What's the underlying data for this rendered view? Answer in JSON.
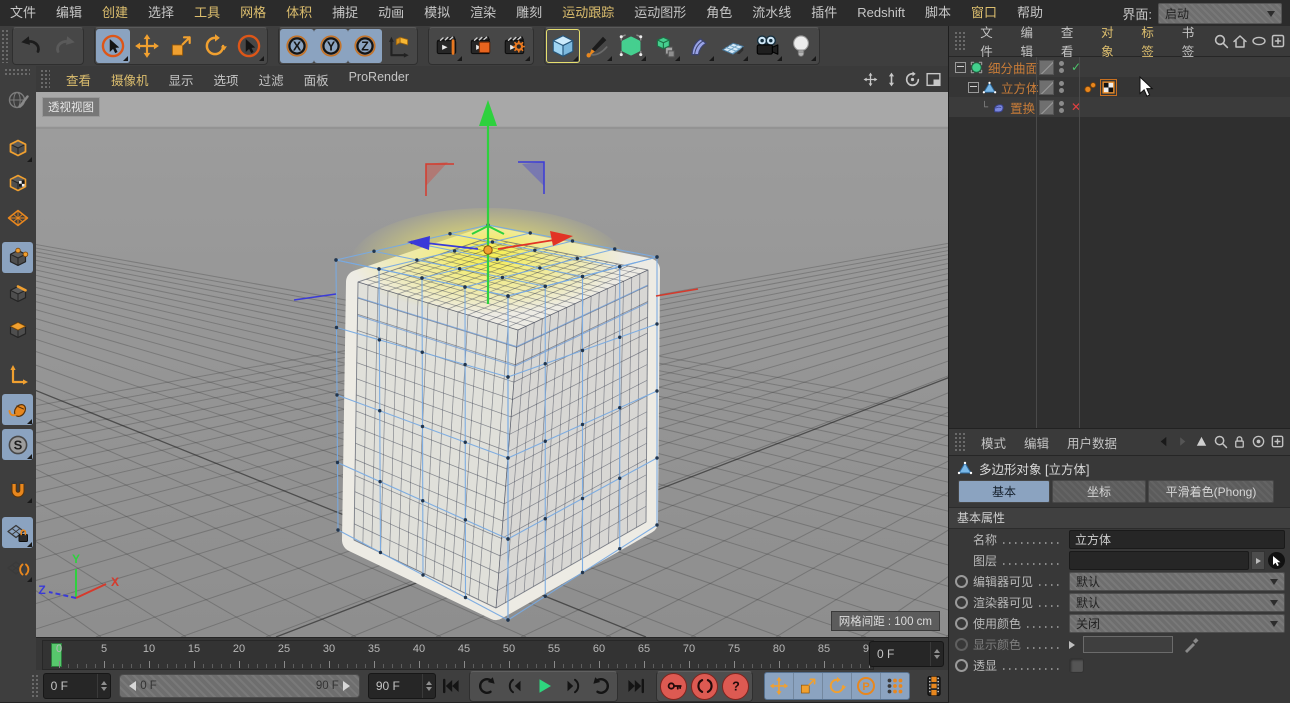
{
  "window": {
    "interface_label": "界面:",
    "interface_value": "启动"
  },
  "menubar": {
    "items": [
      {
        "label": "文件",
        "accent": false
      },
      {
        "label": "编辑",
        "accent": false
      },
      {
        "label": "创建",
        "accent": true
      },
      {
        "label": "选择",
        "accent": false
      },
      {
        "label": "工具",
        "accent": true
      },
      {
        "label": "网格",
        "accent": true
      },
      {
        "label": "体积",
        "accent": true
      },
      {
        "label": "捕捉",
        "accent": false
      },
      {
        "label": "动画",
        "accent": false
      },
      {
        "label": "模拟",
        "accent": false
      },
      {
        "label": "渲染",
        "accent": false
      },
      {
        "label": "雕刻",
        "accent": false
      },
      {
        "label": "运动跟踪",
        "accent": true
      },
      {
        "label": "运动图形",
        "accent": false
      },
      {
        "label": "角色",
        "accent": false
      },
      {
        "label": "流水线",
        "accent": false
      },
      {
        "label": "插件",
        "accent": false
      },
      {
        "label": "Redshift",
        "accent": false
      },
      {
        "label": "脚本",
        "accent": false
      },
      {
        "label": "窗口",
        "accent": true
      },
      {
        "label": "帮助",
        "accent": false
      }
    ]
  },
  "toolbar": {
    "groups": [
      [
        "undo",
        "redo"
      ],
      [
        "live-selection",
        "move",
        "scale",
        "rotate",
        "selection"
      ],
      [
        "axis-x",
        "axis-y",
        "axis-z",
        "coord-system"
      ],
      [
        "render-view",
        "render-region",
        "render-settings"
      ],
      [
        "primitive-cube",
        "spline-pen",
        "subdivision-surface",
        "array-generator",
        "deformer",
        "floor",
        "camera",
        "light"
      ]
    ],
    "blue_active": [
      "live-selection",
      "axis-x",
      "axis-y",
      "axis-z"
    ],
    "yellow_active": [
      "primitive-cube"
    ],
    "disabled": [
      "redo"
    ],
    "submenu_corner": [
      "live-selection",
      "selection",
      "render-view",
      "render-settings",
      "primitive-cube",
      "spline-pen",
      "subdivision-surface",
      "array-generator",
      "deformer",
      "floor",
      "camera",
      "light"
    ]
  },
  "left_toolbar": {
    "items": [
      "paint-globe",
      "model-mode",
      "texture-mode",
      "workplane-mode",
      "points-mode",
      "edges-mode",
      "polygons-mode",
      "axis-mode",
      "viewport-solo",
      "soft-selection",
      "snap",
      "workplane-lock",
      "workplane-orient"
    ],
    "blue_active": [
      "points-mode",
      "viewport-solo",
      "soft-selection",
      "workplane-lock"
    ],
    "disabled": [
      "paint-globe"
    ],
    "submenu_corner": [
      "model-mode",
      "viewport-solo",
      "soft-selection",
      "snap",
      "workplane-lock",
      "workplane-orient"
    ]
  },
  "viewport": {
    "menu": [
      {
        "label": "查看",
        "accent": true
      },
      {
        "label": "摄像机",
        "accent": true
      },
      {
        "label": "显示",
        "accent": false
      },
      {
        "label": "选项",
        "accent": false
      },
      {
        "label": "过滤",
        "accent": false
      },
      {
        "label": "面板",
        "accent": false
      },
      {
        "label": "ProRender",
        "accent": false
      }
    ],
    "corner_icons": [
      "pan",
      "dolly",
      "orbit",
      "layout"
    ],
    "view_label": "透视视图",
    "grid_spacing_label": "网格间距 : 100 cm",
    "axis_labels": {
      "x": "X",
      "y": "Y",
      "z": "Z"
    }
  },
  "object_manager": {
    "menu": [
      {
        "label": "文件",
        "accent": false
      },
      {
        "label": "编辑",
        "accent": false
      },
      {
        "label": "查看",
        "accent": false
      },
      {
        "label": "对象",
        "accent": true
      },
      {
        "label": "标签",
        "accent": true
      },
      {
        "label": "书签",
        "accent": false
      }
    ],
    "corner_icons": [
      "search",
      "home",
      "eye",
      "addbox"
    ],
    "objects": [
      {
        "name": "细分曲面",
        "icon": "subdivision-surface-object",
        "depth": 0,
        "expanded": true,
        "state": "check",
        "tags": []
      },
      {
        "name": "立方体",
        "icon": "polygon-object",
        "depth": 1,
        "expanded": true,
        "state": "",
        "tags": [
          "phong-tag",
          "texture-tag"
        ]
      },
      {
        "name": "置换",
        "icon": "displacer-object",
        "depth": 2,
        "expanded": false,
        "state": "x",
        "tags": []
      }
    ]
  },
  "attribute_manager": {
    "menu": [
      "模式",
      "编辑",
      "用户数据"
    ],
    "corner_icons": [
      "back",
      "fwd",
      "uparrow",
      "search",
      "lock",
      "target",
      "addbox"
    ],
    "title": "多边形对象 [立方体]",
    "tabs": [
      {
        "label": "基本",
        "active": true
      },
      {
        "label": "坐标",
        "active": false
      },
      {
        "label": "平滑着色(Phong)",
        "active": false
      }
    ],
    "section": "基本属性",
    "fields": [
      {
        "label": "名称",
        "type": "text",
        "value": "立方体",
        "radio": "none"
      },
      {
        "label": "图层",
        "type": "layer",
        "value": "",
        "radio": "none"
      },
      {
        "label": "编辑器可见",
        "type": "select",
        "value": "默认",
        "radio": "on"
      },
      {
        "label": "渲染器可见",
        "type": "select",
        "value": "默认",
        "radio": "on"
      },
      {
        "label": "使用颜色",
        "type": "select",
        "value": "关闭",
        "radio": "on"
      },
      {
        "label": "显示颜色",
        "type": "color",
        "value": "",
        "radio": "off"
      },
      {
        "label": "透显",
        "type": "checkbox",
        "value": "off",
        "radio": "on"
      }
    ]
  },
  "timeline": {
    "min": 0,
    "max": 90,
    "label_step": 5,
    "current_frame_label": "0 F",
    "range_start_label": "0 F",
    "range_end_label": "90 F",
    "end_frame_label": "90 F"
  },
  "transport": {
    "buttons": [
      "goto-start"
    ],
    "frame_group": [
      "prev-key",
      "prev-frame",
      "play",
      "next-frame",
      "next-key"
    ],
    "buttons_end": [
      "goto-end"
    ],
    "record_group": [
      "record-key",
      "autokey",
      "help"
    ],
    "keying_group": [
      "k-move",
      "k-scale",
      "k-rotate",
      "k-param",
      "k-dots"
    ],
    "film": "film"
  },
  "colors": {
    "accent_orange": "#f0a030",
    "menu_accent": "#dcbe6e",
    "selection_blue": "#8ba3c0",
    "object_text": "#c87c38",
    "green_check": "#4cc46a",
    "red_x": "#e04040",
    "play_green": "#2fd57e",
    "record_red": "#dd5a52",
    "viewport_bg": "#9c9c9c"
  }
}
